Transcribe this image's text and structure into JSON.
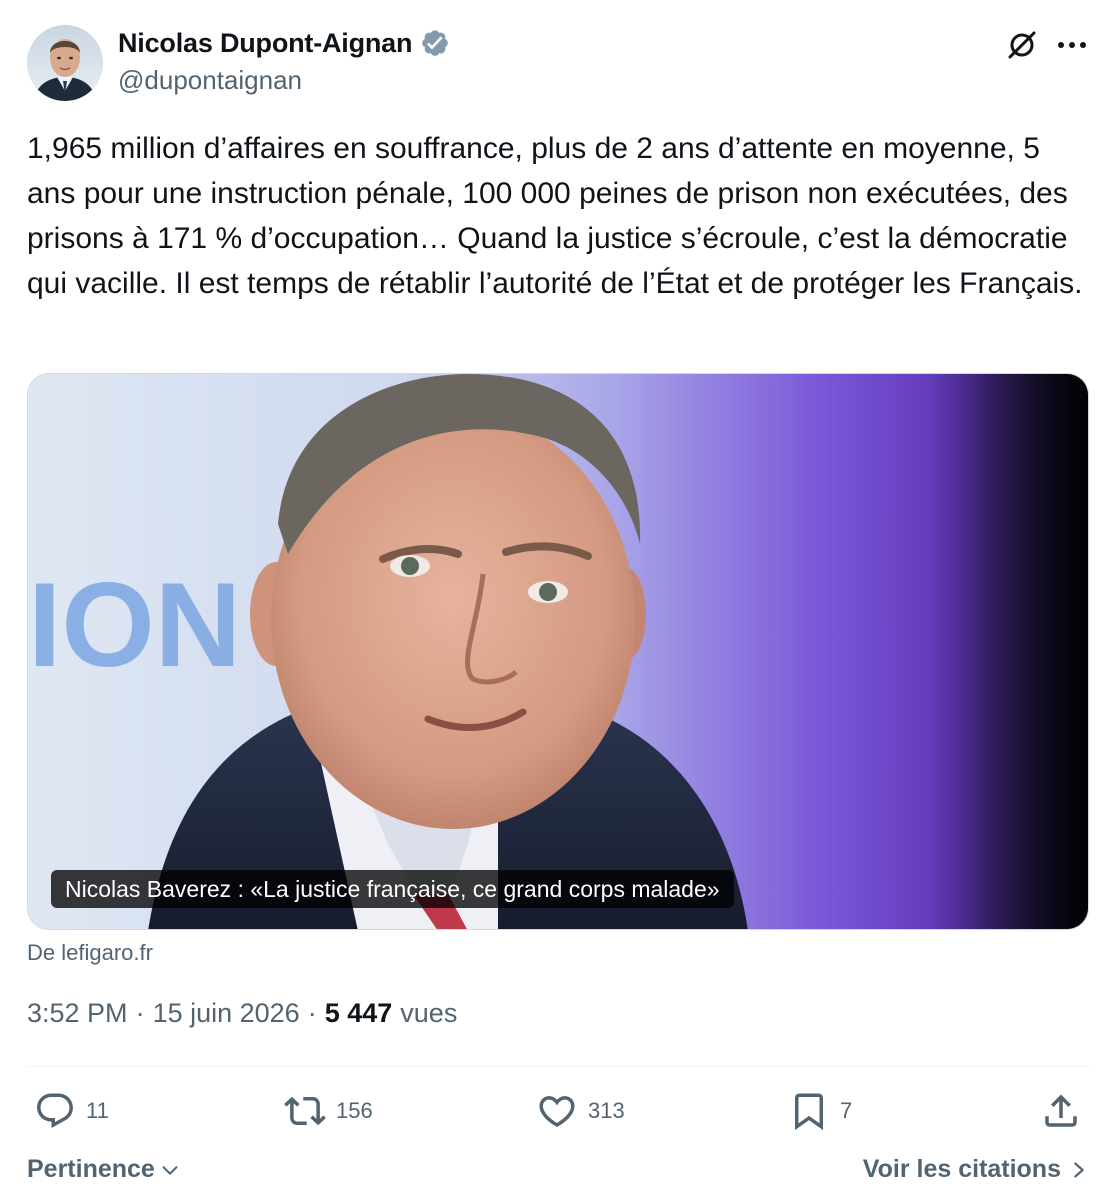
{
  "author": {
    "name": "Nicolas Dupont-Aignan",
    "handle": "@dupontaignan",
    "verified": true
  },
  "tweet": {
    "text": "1,965 million d’affaires en souffrance, plus de 2 ans d’attente en moyenne, 5 ans pour une instruction pénale, 100 000 peines de prison non exécutées, des prisons à 171 % d’occupation… Quand la justice s’écroule, c’est la démocratie qui vacille. Il est temps de rétablir l’autorité de l’État et de protéger les Français."
  },
  "card": {
    "caption": "Nicolas Baverez : «La justice française, ce grand corps malade»",
    "background_text": "ION",
    "source": "De lefigaro.fr"
  },
  "meta": {
    "time": "3:52 PM",
    "separator": "·",
    "date": "15 juin 2026",
    "views_count": "5 447",
    "views_label": "vues"
  },
  "actions": {
    "replies": "11",
    "reposts": "156",
    "likes": "313",
    "bookmarks": "7"
  },
  "footer": {
    "sort_label": "Pertinence",
    "quotes_label": "Voir les citations"
  },
  "icons": {
    "verified": "verified-badge-icon",
    "grok": "grok-icon",
    "more": "more-icon",
    "reply": "reply-icon",
    "repost": "repost-icon",
    "like": "heart-icon",
    "bookmark": "bookmark-icon",
    "share": "share-icon"
  },
  "colors": {
    "text_primary": "#0f1419",
    "text_secondary": "#536471",
    "verified_badge": "#829aab",
    "divider": "#eff3f4"
  }
}
